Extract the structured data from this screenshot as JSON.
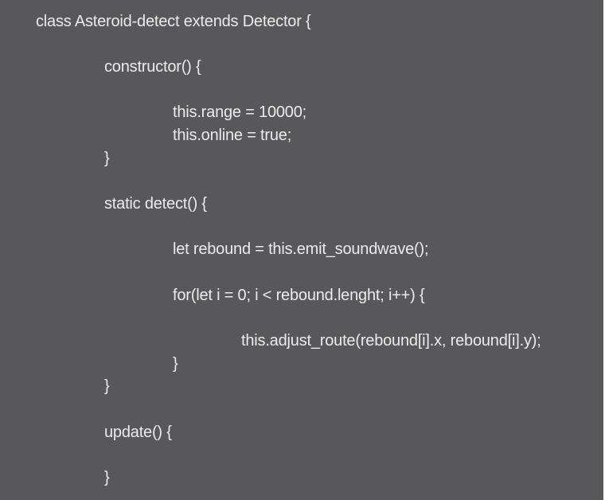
{
  "code": {
    "lines": [
      "class Asteroid-detect extends Detector {",
      "constructor() {",
      "this.range = 10000;",
      "this.online = true;",
      "}",
      "static detect() {",
      "let rebound = this.emit_soundwave();",
      "for(let i = 0; i < rebound.lenght; i++) {",
      "this.adjust_route(rebound[i].x, rebound[i].y);",
      "}",
      "}",
      "update() {",
      "}"
    ]
  },
  "colors": {
    "background": "#58585a",
    "text": "#ebebeb"
  }
}
